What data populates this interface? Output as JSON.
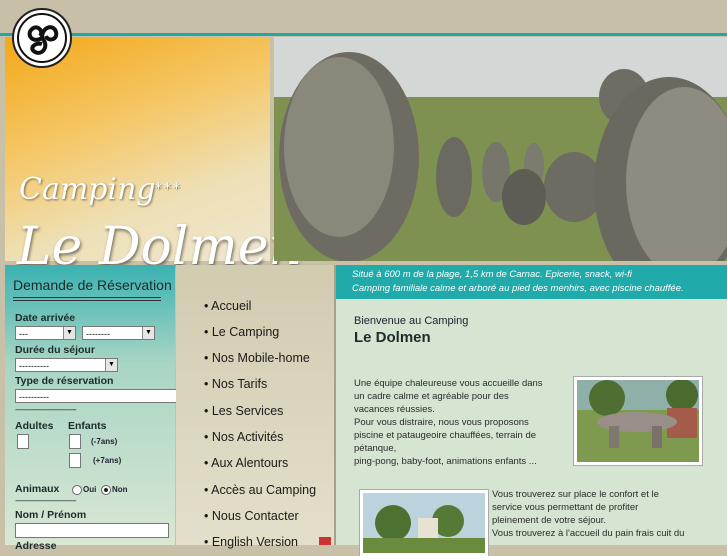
{
  "brand": {
    "camping": "Camping",
    "stars": "***",
    "name": "Le Dolmen"
  },
  "reservation": {
    "title": "Demande de Réservation",
    "date_label": "Date arrivée",
    "date_day": "---",
    "date_month": "--------",
    "duration_label": "Durée du séjour",
    "duration_value": "----------",
    "type_label": "Type de réservation",
    "type_value": "----------",
    "separator": "---------------------------",
    "adults_label": "Adultes",
    "children_label": "Enfants",
    "under7": "(-7ans)",
    "over7": "(+7ans)",
    "animals_label": "Animaux",
    "animals_yes": "Oui",
    "animals_no": "Non",
    "name_label": "Nom / Prénom",
    "address_label": "Adresse"
  },
  "nav": {
    "items": [
      "• Accueil",
      "• Le Camping",
      "• Nos Mobile-home",
      "• Nos Tarifs",
      "• Les Services",
      "• Nos Activités",
      "• Aux Alentours",
      "• Accès au Camping",
      "• Nous Contacter",
      "• English Version"
    ]
  },
  "main": {
    "tagline1": "Situé à 600 m de la plage, 1,5 km de Carnac. Epicerie, snack, wi-fi",
    "tagline2": "Camping familiale calme et arboré au pied des menhirs, avec piscine chauffée.",
    "welcome": "Bienvenue au Camping",
    "title": "Le Dolmen",
    "para1": [
      "Une équipe chaleureuse vous accueille dans",
      "un cadre calme et agréable pour des",
      "vacances réussies.",
      "Pour vous distraire, nous vous proposons",
      "piscine et pataugeoire chauffées, terrain de",
      "pétanque,",
      "ping-pong, baby-foot, animations enfants ..."
    ],
    "para2": [
      "Vous trouverez sur place le confort et le",
      "service vous permettant de profiter",
      "pleinement de votre séjour.",
      "Vous trouverez à l'accueil du pain frais cuit du"
    ]
  }
}
